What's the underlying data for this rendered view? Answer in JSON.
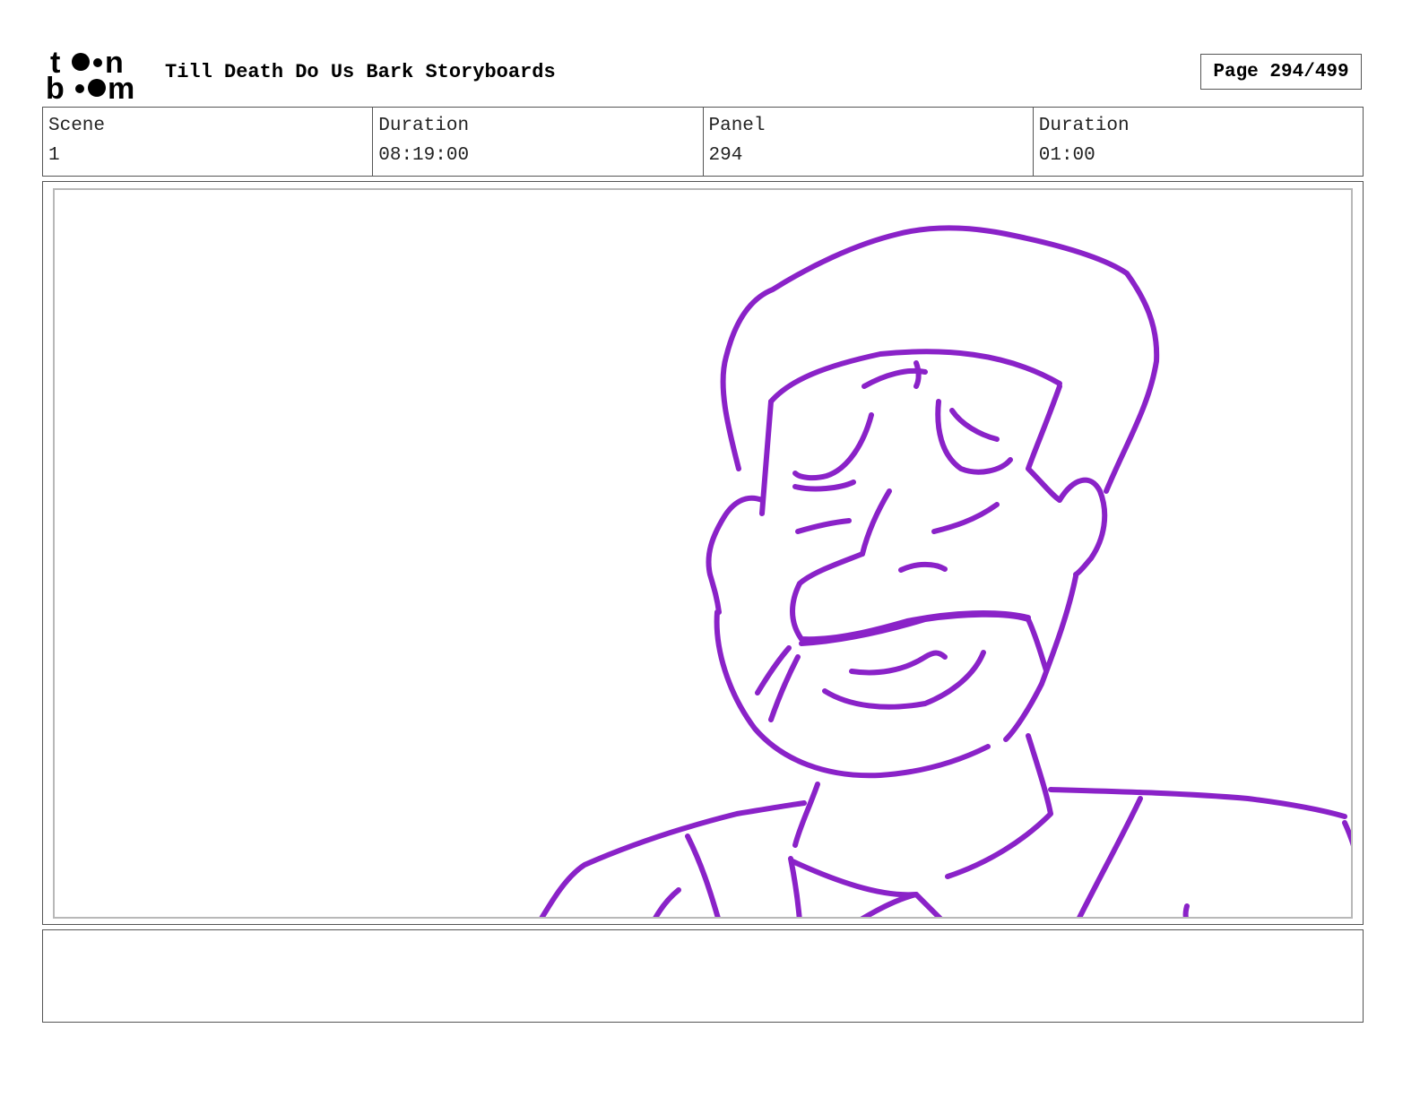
{
  "header": {
    "logo_text": [
      "t",
      "n",
      "b",
      "m"
    ],
    "title": "Till Death Do Us Bark Storyboards",
    "page_label": "Page",
    "page_value": "294/499"
  },
  "info": {
    "scene_label": "Scene",
    "scene_value": "1",
    "scene_duration_label": "Duration",
    "scene_duration_value": "08:19:00",
    "panel_label": "Panel",
    "panel_value": "294",
    "panel_duration_label": "Duration",
    "panel_duration_value": "01:00"
  },
  "drawing": {
    "stroke_color": "#8a22c8",
    "subject": "character-sketch"
  },
  "caption": {
    "text": ""
  }
}
